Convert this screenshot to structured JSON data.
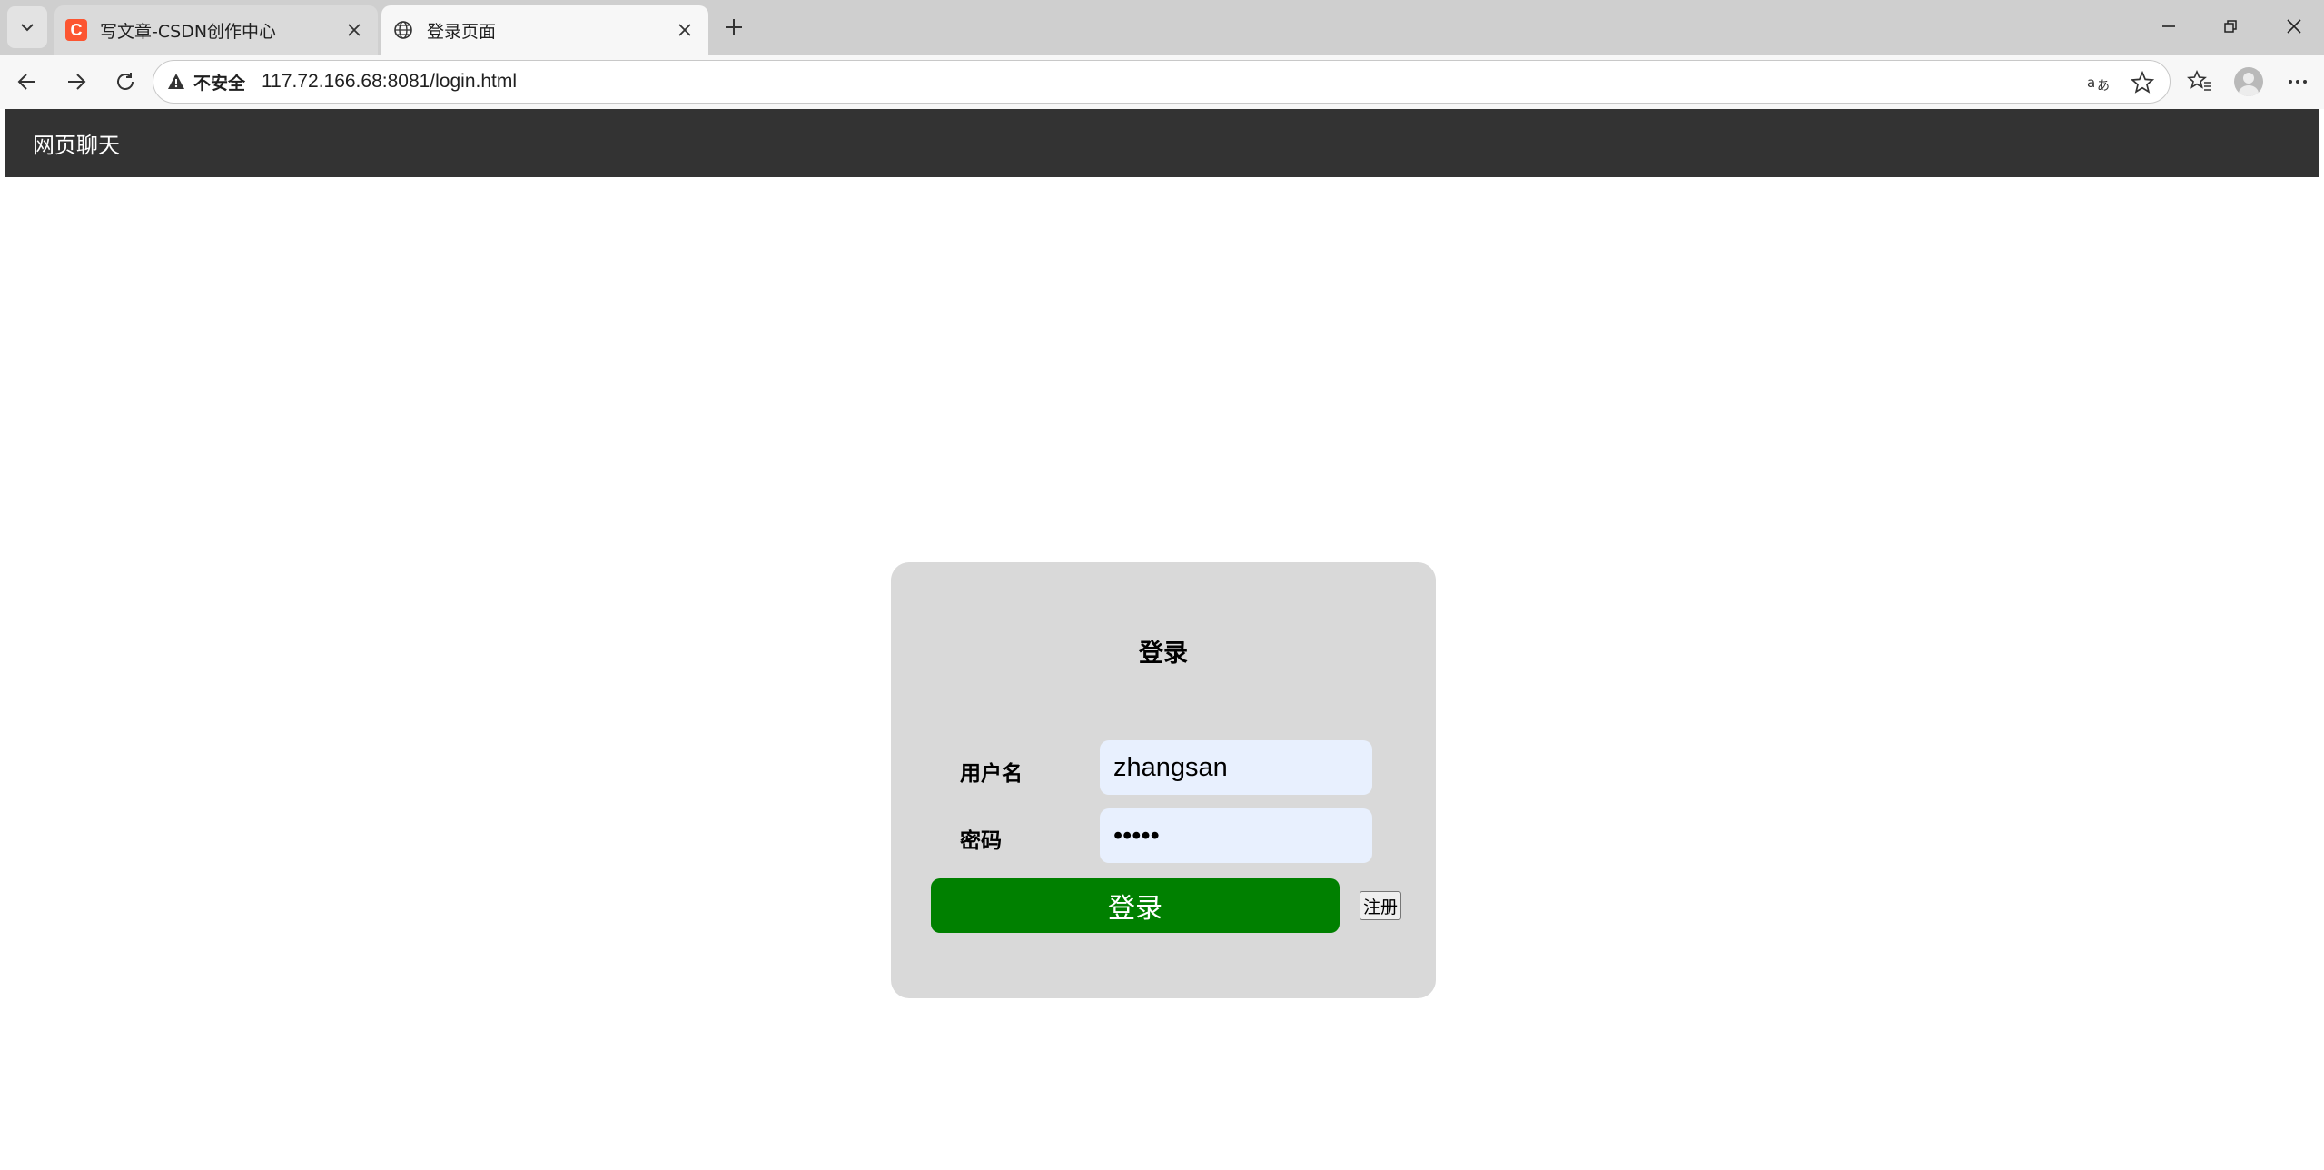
{
  "browser": {
    "tabs": [
      {
        "title": "写文章-CSDN创作中心",
        "favicon_letter": "C",
        "active": false
      },
      {
        "title": "登录页面",
        "active": true
      }
    ],
    "address": {
      "security_label": "不安全",
      "url": "117.72.166.68:8081/login.html"
    }
  },
  "page": {
    "navbar": {
      "brand": "网页聊天"
    },
    "login": {
      "title": "登录",
      "username_label": "用户名",
      "username_value": "zhangsan",
      "password_label": "密码",
      "password_value": "•••••",
      "submit_label": "登录",
      "register_label": "注册"
    }
  },
  "colors": {
    "navbar_bg": "#333333",
    "card_bg": "#d9d9d9",
    "input_bg": "#e8f0fe",
    "login_button_bg": "#008000"
  }
}
